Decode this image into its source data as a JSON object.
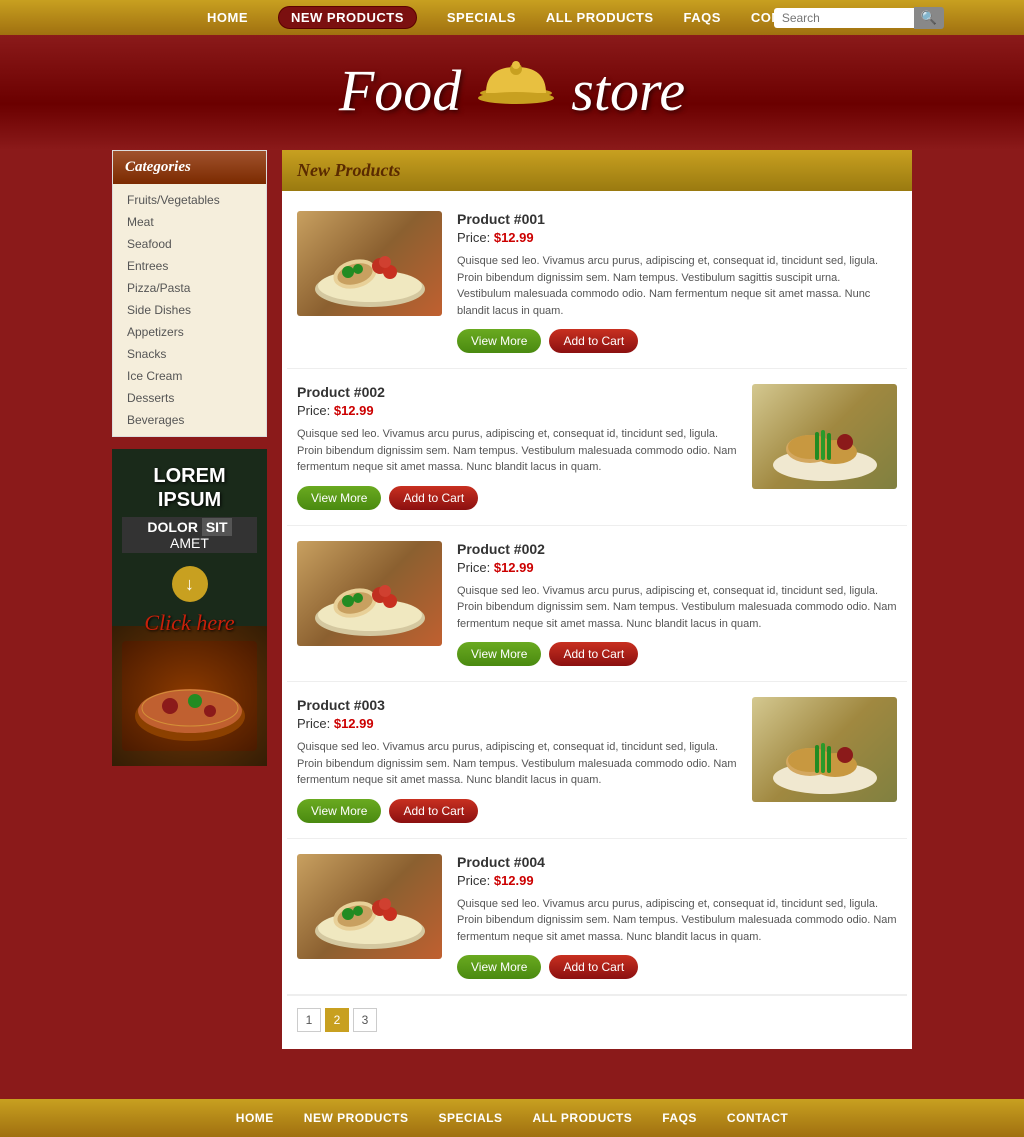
{
  "nav": {
    "items": [
      {
        "label": "HOME",
        "active": false
      },
      {
        "label": "NEW PRODUCTS",
        "active": true
      },
      {
        "label": "SPECIALS",
        "active": false
      },
      {
        "label": "ALL PRODUCTS",
        "active": false
      },
      {
        "label": "FAQS",
        "active": false
      },
      {
        "label": "CONTACT",
        "active": false
      }
    ],
    "search_placeholder": "Search"
  },
  "logo": {
    "text_part1": "Food",
    "text_part2": "store"
  },
  "sidebar": {
    "categories_title": "Categories",
    "categories": [
      "Fruits/Vegetables",
      "Meat",
      "Seafood",
      "Entrees",
      "Pizza/Pasta",
      "Side Dishes",
      "Appetizers",
      "Snacks",
      "Ice Cream",
      "Desserts",
      "Beverages"
    ],
    "ad": {
      "lorem": "LOREM IPSUM",
      "dolor": "DOLOR",
      "sit": "SIT",
      "amet": "AMET",
      "click": "Click here"
    }
  },
  "products": {
    "section_title": "New Products",
    "items": [
      {
        "id": "001",
        "title": "Product #001",
        "price": "$12.99",
        "description": "Quisque sed leo. Vivamus arcu purus, adipiscing et, consequat id, tincidunt sed, ligula. Proin bibendum dignissim sem. Nam tempus. Vestibulum sagittis suscipit urna. Vestibulum malesuada commodo odio. Nam fermentum neque sit amet massa. Nunc blandit lacus in quam.",
        "image_type": "food1",
        "layout": "left"
      },
      {
        "id": "002a",
        "title": "Product #002",
        "price": "$12.99",
        "description": "Quisque sed leo. Vivamus arcu purus, adipiscing et, consequat id, tincidunt sed, ligula. Proin bibendum dignissim sem. Nam tempus. Vestibulum malesuada commodo odio. Nam fermentum neque sit amet massa. Nunc blandit lacus in quam.",
        "image_type": "food2",
        "layout": "right"
      },
      {
        "id": "002b",
        "title": "Product #002",
        "price": "$12.99",
        "description": "Quisque sed leo. Vivamus arcu purus, adipiscing et, consequat id, tincidunt sed, ligula. Proin bibendum dignissim sem. Nam tempus. Vestibulum malesuada commodo odio. Nam fermentum neque sit amet massa. Nunc blandit lacus in quam.",
        "image_type": "food1",
        "layout": "left"
      },
      {
        "id": "003",
        "title": "Product #003",
        "price": "$12.99",
        "description": "Quisque sed leo. Vivamus arcu purus, adipiscing et, consequat id, tincidunt sed, ligula. Proin bibendum dignissim sem. Nam tempus. Vestibulum malesuada commodo odio. Nam fermentum neque sit amet massa. Nunc blandit lacus in quam.",
        "image_type": "food2",
        "layout": "right"
      },
      {
        "id": "004",
        "title": "Product #004",
        "price": "$12.99",
        "description": "Quisque sed leo. Vivamus arcu purus, adipiscing et, consequat id, tincidunt sed, ligula. Proin bibendum dignissim sem. Nam tempus. Vestibulum malesuada commodo odio. Nam fermentum neque sit amet massa. Nunc blandit lacus in quam.",
        "image_type": "food1",
        "layout": "left"
      }
    ],
    "btn_view": "View More",
    "btn_cart": "Add to Cart"
  },
  "pagination": {
    "pages": [
      "1",
      "2",
      "3"
    ],
    "active": "2"
  },
  "footer_nav": {
    "items": [
      "HOME",
      "NEW PRODUCTS",
      "SPECIALS",
      "ALL PRODUCTS",
      "FAQS",
      "CONTACT"
    ]
  }
}
